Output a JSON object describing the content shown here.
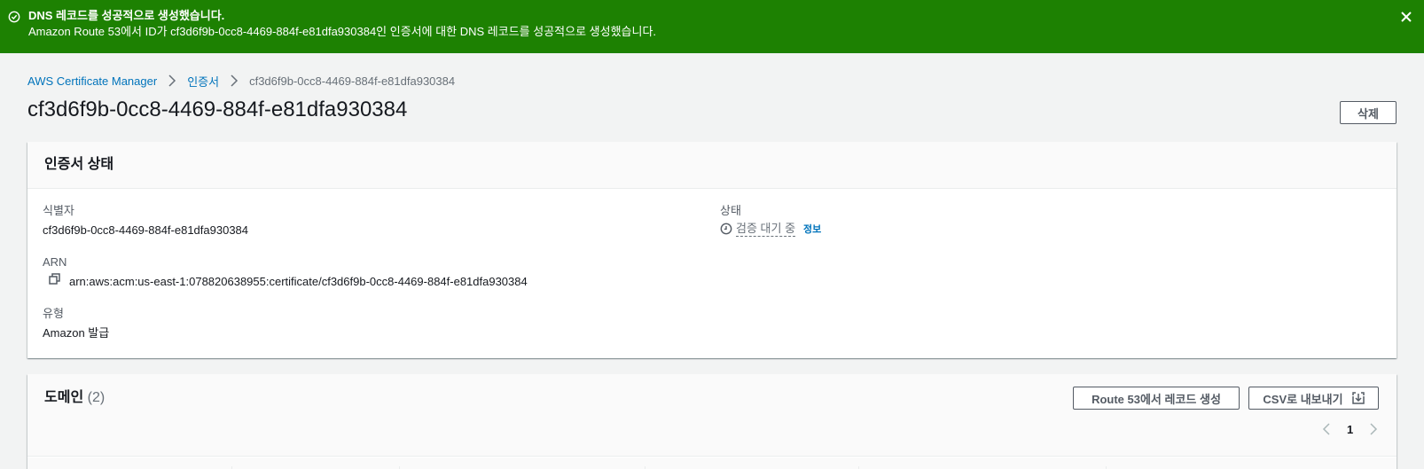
{
  "flash": {
    "title": "DNS 레코드를 성공적으로 생성했습니다.",
    "message": "Amazon Route 53에서 ID가 cf3d6f9b-0cc8-4469-884f-e81dfa930384인 인증서에 대한 DNS 레코드를 성공적으로 생성했습니다.",
    "icon": "check-circle-icon",
    "close_icon": "close-icon",
    "color": "#1d8102"
  },
  "breadcrumb": {
    "items": [
      "AWS Certificate Manager",
      "인증서"
    ],
    "current": "cf3d6f9b-0cc8-4469-884f-e81dfa930384"
  },
  "header": {
    "title": "cf3d6f9b-0cc8-4469-884f-e81dfa930384",
    "delete_label": "삭제"
  },
  "status_panel": {
    "title": "인증서 상태",
    "identifier_label": "식별자",
    "identifier_value": "cf3d6f9b-0cc8-4469-884f-e81dfa930384",
    "status_label": "상태",
    "status_value": "검증 대기 중",
    "status_icon": "clock-icon",
    "info_link": "정보",
    "arn_label": "ARN",
    "arn_value": "arn:aws:acm:us-east-1:078820638955:certificate/cf3d6f9b-0cc8-4469-884f-e81dfa930384",
    "type_label": "유형",
    "type_value": "Amazon 발급"
  },
  "domains_panel": {
    "title": "도메인",
    "count": "(2)",
    "route53_button": "Route 53에서 레코드 생성",
    "csv_button": "CSV로 내보내기",
    "page": "1"
  },
  "colors": {
    "link": "#0073bb",
    "background": "#f2f3f3"
  }
}
